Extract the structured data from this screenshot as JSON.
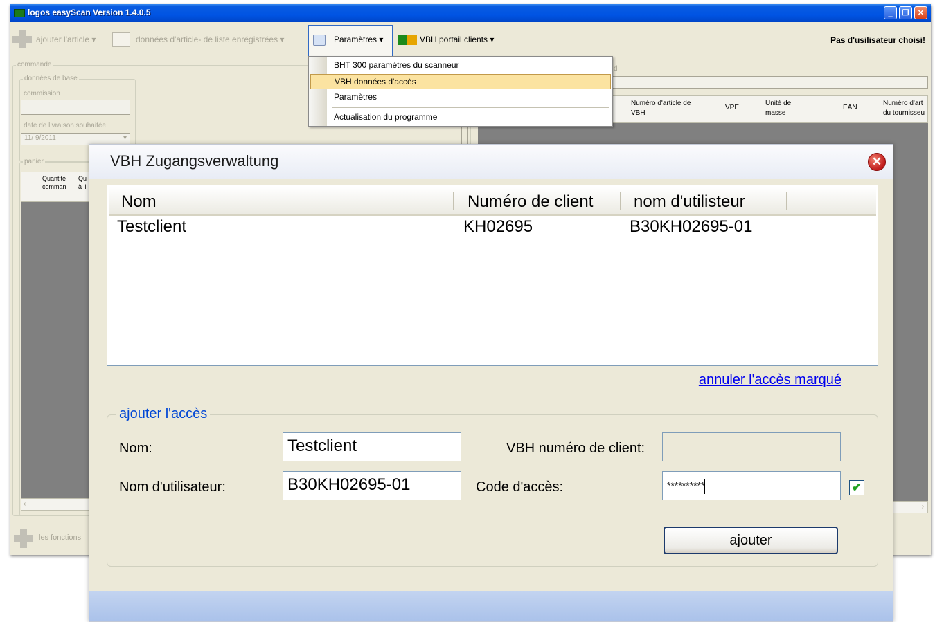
{
  "main": {
    "title": "logos easyScan Version 1.4.0.5",
    "window_buttons": {
      "minimize": "_",
      "maximize": "❐",
      "close": "✕"
    },
    "toolbar": {
      "add_article": "ajouter l'article",
      "saved_list": "données d'article- de liste enrégistrées",
      "parameters": "Paramètres",
      "portal": "VBH portail clients",
      "dropdown_arrow": "▾"
    },
    "user_status": "Pas d'usilisateur choisi!",
    "order": {
      "group": "commande",
      "base_group": "données de base",
      "commission_label": "commission",
      "date_label": "date de livraison souhaitée",
      "date_value": "11/ 9/2011",
      "cart_group": "panier",
      "cart_col1": "Quantité comman",
      "cart_col2": "Qu à li"
    },
    "articles": {
      "header_fragment": "d",
      "columns": [
        "Numéro d'article de VBH",
        "VPE",
        "Unité de masse",
        "EAN",
        "Numéro d'art du tournisseu"
      ]
    },
    "functions": "les fonctions"
  },
  "dropdown": {
    "items": [
      "BHT 300 paramètres du scanneur",
      "VBH données d'accès",
      "Paramètres",
      "Actualisation du programme"
    ],
    "selected_index": 1
  },
  "dialog": {
    "title": "VBH Zugangsverwaltung",
    "close_glyph": "✕",
    "columns": [
      "Nom",
      "Numéro de client",
      "nom d'utilisteur"
    ],
    "rows": [
      {
        "name": "Testclient",
        "client_number": "KH02695",
        "username": "B30KH02695-01"
      }
    ],
    "cancel_link": "annuler l'accès marqué",
    "add_group_title": "ajouter l'accès",
    "labels": {
      "name": "Nom:",
      "client_number": "VBH numéro de client:",
      "username": "Nom d'utilisateur:",
      "access_code": "Code d'accès:"
    },
    "fields": {
      "name": "Testclient",
      "client_number": "",
      "username": "B30KH02695-01",
      "access_code": "**********"
    },
    "checkbox_checked": true,
    "checkbox_glyph": "✔",
    "add_button": "ajouter"
  }
}
